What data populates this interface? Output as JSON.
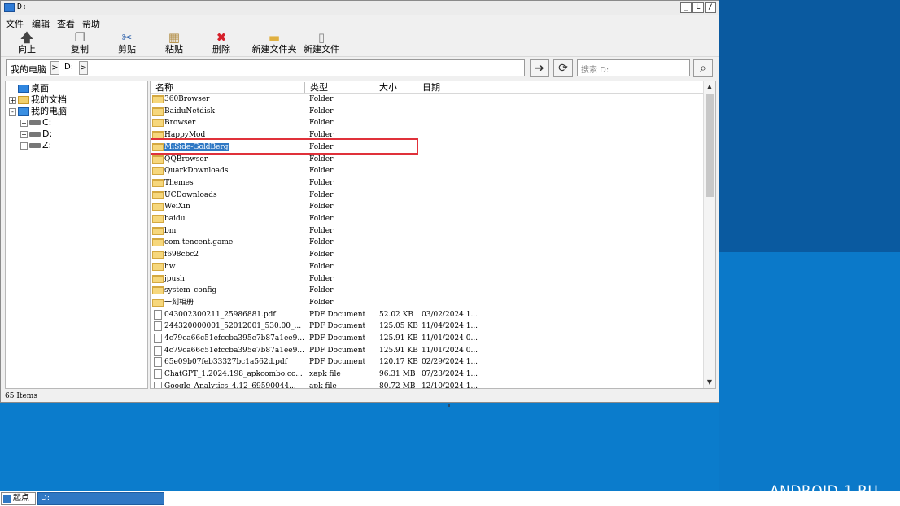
{
  "window": {
    "title": "D:",
    "btn_minimize": "_",
    "btn_restore": "L",
    "btn_close": "/"
  },
  "menu": [
    "文件",
    "编辑",
    "查看",
    "帮助"
  ],
  "toolbar": {
    "up": "向上",
    "copy": "复制",
    "cut": "剪贴",
    "paste": "粘贴",
    "delete": "删除",
    "new_folder": "新建文件夹",
    "new_file": "新建文件"
  },
  "address": {
    "crumb_root": "我的电脑",
    "crumb_drive": "D:",
    "search_placeholder": "搜索 D:"
  },
  "tree": [
    {
      "label": "桌面",
      "icon": "desktop-icon",
      "expander": ""
    },
    {
      "label": "我的文档",
      "icon": "documents-icon",
      "expander": "+"
    },
    {
      "label": "我的电脑",
      "icon": "computer-icon",
      "expander": "-"
    },
    {
      "label": "C:",
      "icon": "drive-icon",
      "expander": "+"
    },
    {
      "label": "D:",
      "icon": "drive-icon",
      "expander": "+"
    },
    {
      "label": "Z:",
      "icon": "drive-icon",
      "expander": "+"
    }
  ],
  "columns": {
    "name": "名称",
    "type": "类型",
    "size": "大小",
    "date": "日期"
  },
  "files": [
    {
      "name": "360Browser",
      "type": "Folder",
      "size": "",
      "date": "",
      "kind": "folder"
    },
    {
      "name": "BaiduNetdisk",
      "type": "Folder",
      "size": "",
      "date": "",
      "kind": "folder"
    },
    {
      "name": "Browser",
      "type": "Folder",
      "size": "",
      "date": "",
      "kind": "folder"
    },
    {
      "name": "HappyMod",
      "type": "Folder",
      "size": "",
      "date": "",
      "kind": "folder"
    },
    {
      "name": "MiSide-GoldBerg",
      "type": "Folder",
      "size": "",
      "date": "",
      "kind": "folder",
      "selected": true
    },
    {
      "name": "QQBrowser",
      "type": "Folder",
      "size": "",
      "date": "",
      "kind": "folder"
    },
    {
      "name": "QuarkDownloads",
      "type": "Folder",
      "size": "",
      "date": "",
      "kind": "folder"
    },
    {
      "name": "Themes",
      "type": "Folder",
      "size": "",
      "date": "",
      "kind": "folder"
    },
    {
      "name": "UCDownloads",
      "type": "Folder",
      "size": "",
      "date": "",
      "kind": "folder"
    },
    {
      "name": "WeiXin",
      "type": "Folder",
      "size": "",
      "date": "",
      "kind": "folder"
    },
    {
      "name": "baidu",
      "type": "Folder",
      "size": "",
      "date": "",
      "kind": "folder"
    },
    {
      "name": "bm",
      "type": "Folder",
      "size": "",
      "date": "",
      "kind": "folder"
    },
    {
      "name": "com.tencent.game",
      "type": "Folder",
      "size": "",
      "date": "",
      "kind": "folder"
    },
    {
      "name": "f698cbc2",
      "type": "Folder",
      "size": "",
      "date": "",
      "kind": "folder"
    },
    {
      "name": "hw",
      "type": "Folder",
      "size": "",
      "date": "",
      "kind": "folder"
    },
    {
      "name": "jpush",
      "type": "Folder",
      "size": "",
      "date": "",
      "kind": "folder"
    },
    {
      "name": "system_config",
      "type": "Folder",
      "size": "",
      "date": "",
      "kind": "folder"
    },
    {
      "name": "一刻相册",
      "type": "Folder",
      "size": "",
      "date": "",
      "kind": "folder"
    },
    {
      "name": "043002300211_25986881.pdf",
      "type": "PDF Document",
      "size": "52.02 KB",
      "date": "03/02/2024 1...",
      "kind": "file"
    },
    {
      "name": "244320000001_52012001_530.00_...",
      "type": "PDF Document",
      "size": "125.05 KB",
      "date": "11/04/2024 1...",
      "kind": "file"
    },
    {
      "name": "4c79ca66c51efccba395e7b87a1ee9...",
      "type": "PDF Document",
      "size": "125.91 KB",
      "date": "11/01/2024 0...",
      "kind": "file"
    },
    {
      "name": "4c79ca66c51efccba395e7b87a1ee9...",
      "type": "PDF Document",
      "size": "125.91 KB",
      "date": "11/01/2024 0...",
      "kind": "file"
    },
    {
      "name": "65e09b07feb33327bc1a562d.pdf",
      "type": "PDF Document",
      "size": "120.17 KB",
      "date": "02/29/2024 1...",
      "kind": "file"
    },
    {
      "name": "ChatGPT_1.2024.198_apkcombo.co...",
      "type": "xapk file",
      "size": "96.31 MB",
      "date": "07/23/2024 1...",
      "kind": "file"
    },
    {
      "name": "Google_Analytics_4.12_69590044...",
      "type": "apk file",
      "size": "80.72 MB",
      "date": "12/10/2024 1...",
      "kind": "file"
    }
  ],
  "status": "65 Items",
  "taskbar": {
    "start": "起点",
    "active_window": "D:"
  },
  "watermark": "ANDROID-1.RU",
  "colors": {
    "selection": "#2f78c4",
    "highlight_border": "#e0313a",
    "desktop": "#0b79c9"
  }
}
